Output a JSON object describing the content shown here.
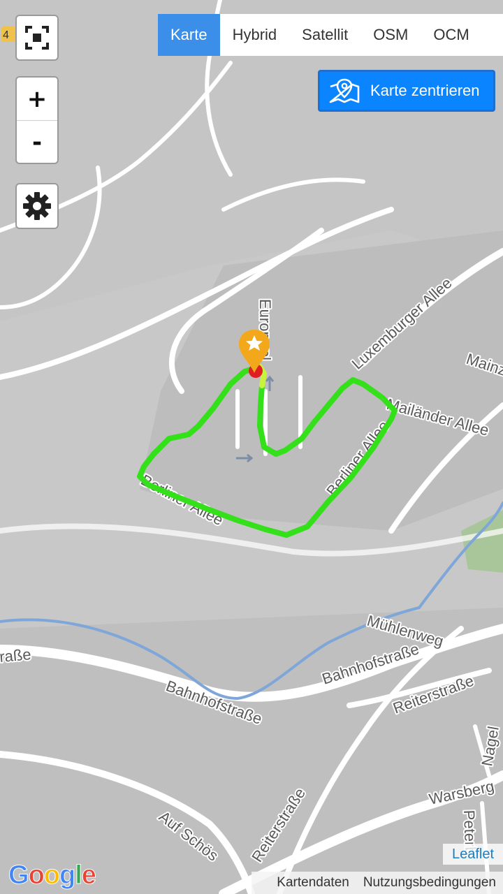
{
  "controls": {
    "zoom_in_label": "+",
    "zoom_out_label": "-"
  },
  "layer_tabs": [
    {
      "label": "Karte",
      "active": true
    },
    {
      "label": "Hybrid",
      "active": false
    },
    {
      "label": "Satellit",
      "active": false
    },
    {
      "label": "OSM",
      "active": false
    },
    {
      "label": "OCM",
      "active": false
    }
  ],
  "center_button": {
    "label": "Karte zentrieren",
    "icon": "map-pin-icon"
  },
  "streets": {
    "road_badge": "4",
    "europaplatz": "Europapl",
    "luxemburger": "Luxemburger Allee",
    "mainz": "Mainz",
    "mailaender": "Mailänder Allee",
    "berliner_lower": "Berliner Allee",
    "berliner_right": "Berliner Allee",
    "muehlenweg": "Mühlenweg",
    "strasse_left": "raße",
    "bahnhof_right": "Bahnhofstraße",
    "bahnhof_left": "Bahnhofstraße",
    "reiter_right": "Reiterstraße",
    "reiter_lower": "Reiterstraße",
    "auf_schoes": "Auf Schös",
    "warsberg": "Warsberg",
    "peter": "Peterb",
    "nagel": "Nagel"
  },
  "attribution": {
    "leaflet": "Leaflet",
    "google": "Google",
    "map_data": "Kartendaten",
    "terms": "Nutzungsbedingungen"
  },
  "colors": {
    "track": "#33e01a",
    "track_end": "#c8f23c",
    "marker": "#f3a81c",
    "start_dot": "#e02020",
    "accent": "#0a84ff"
  }
}
